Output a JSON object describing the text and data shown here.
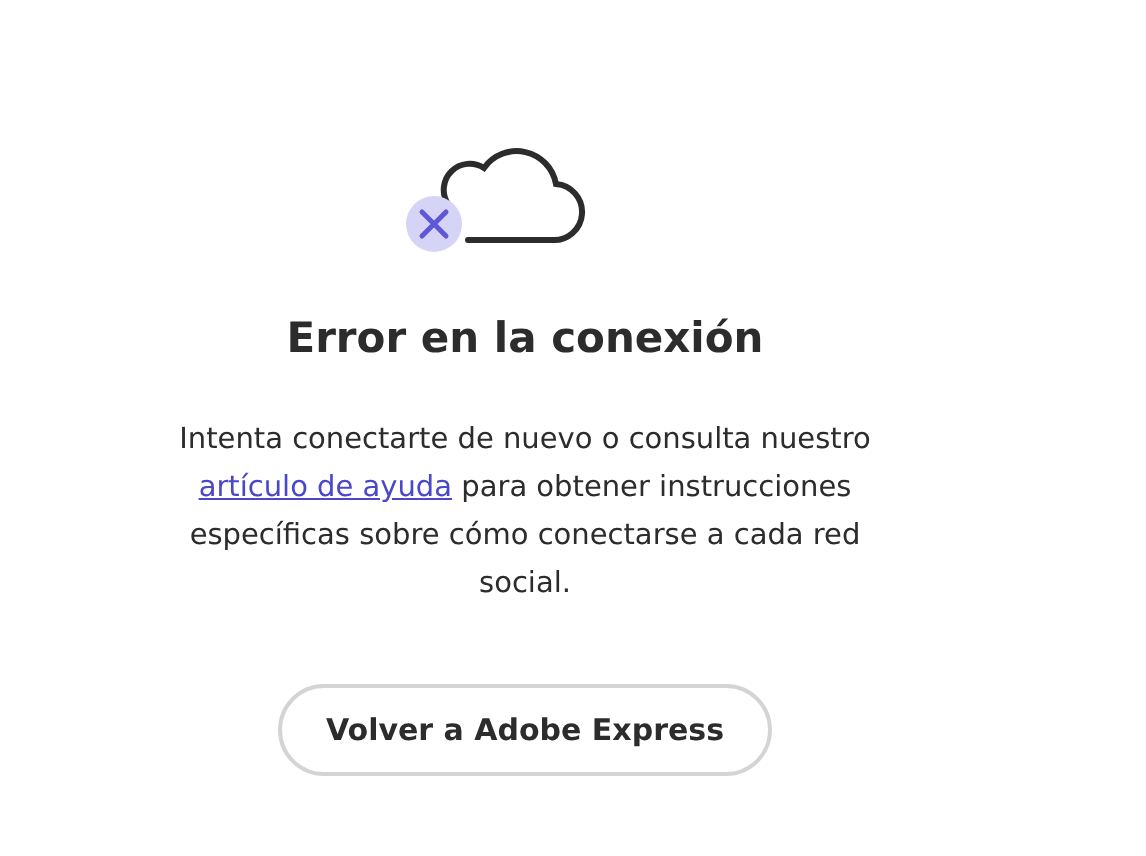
{
  "title": "Error en la conexión",
  "message": {
    "before": "Intenta conectarte de nuevo o consulta nuestro ",
    "link": "artículo de ayuda",
    "after": " para obtener instrucciones específicas sobre cómo conectarse a cada red social."
  },
  "button": "Volver a Adobe Express"
}
